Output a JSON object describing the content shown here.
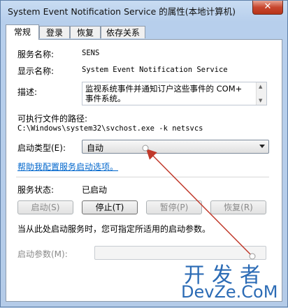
{
  "window": {
    "title": "System Event Notification Service 的属性(本地计算机)",
    "close_label": "✕"
  },
  "tabs": [
    {
      "label": "常规",
      "active": true
    },
    {
      "label": "登录",
      "active": false
    },
    {
      "label": "恢复",
      "active": false
    },
    {
      "label": "依存关系",
      "active": false
    }
  ],
  "general": {
    "service_name_label": "服务名称:",
    "service_name_value": "SENS",
    "display_name_label": "显示名称:",
    "display_name_value": "System Event Notification Service",
    "description_label": "描述:",
    "description_value": "监视系统事件并通知订户这些事件的 COM+ 事件系统。",
    "exe_path_label": "可执行文件的路径:",
    "exe_path_value": "C:\\Windows\\system32\\svchost.exe -k netsvcs",
    "startup_type_label": "启动类型(E):",
    "startup_type_value": "自动",
    "help_link": "帮助我配置服务启动选项。",
    "status_label": "服务状态:",
    "status_value": "已启动",
    "buttons": {
      "start": "启动(S)",
      "stop": "停止(T)",
      "pause": "暂停(P)",
      "resume": "恢复(R)"
    },
    "hint_text": "当从此处启动服务时，您可指定所适用的启动参数。",
    "start_params_label": "启动参数(M):",
    "start_params_value": ""
  },
  "watermark": {
    "cn": "开发者",
    "en": "DevZe.CoM"
  },
  "annotation_color": "#c0392b"
}
